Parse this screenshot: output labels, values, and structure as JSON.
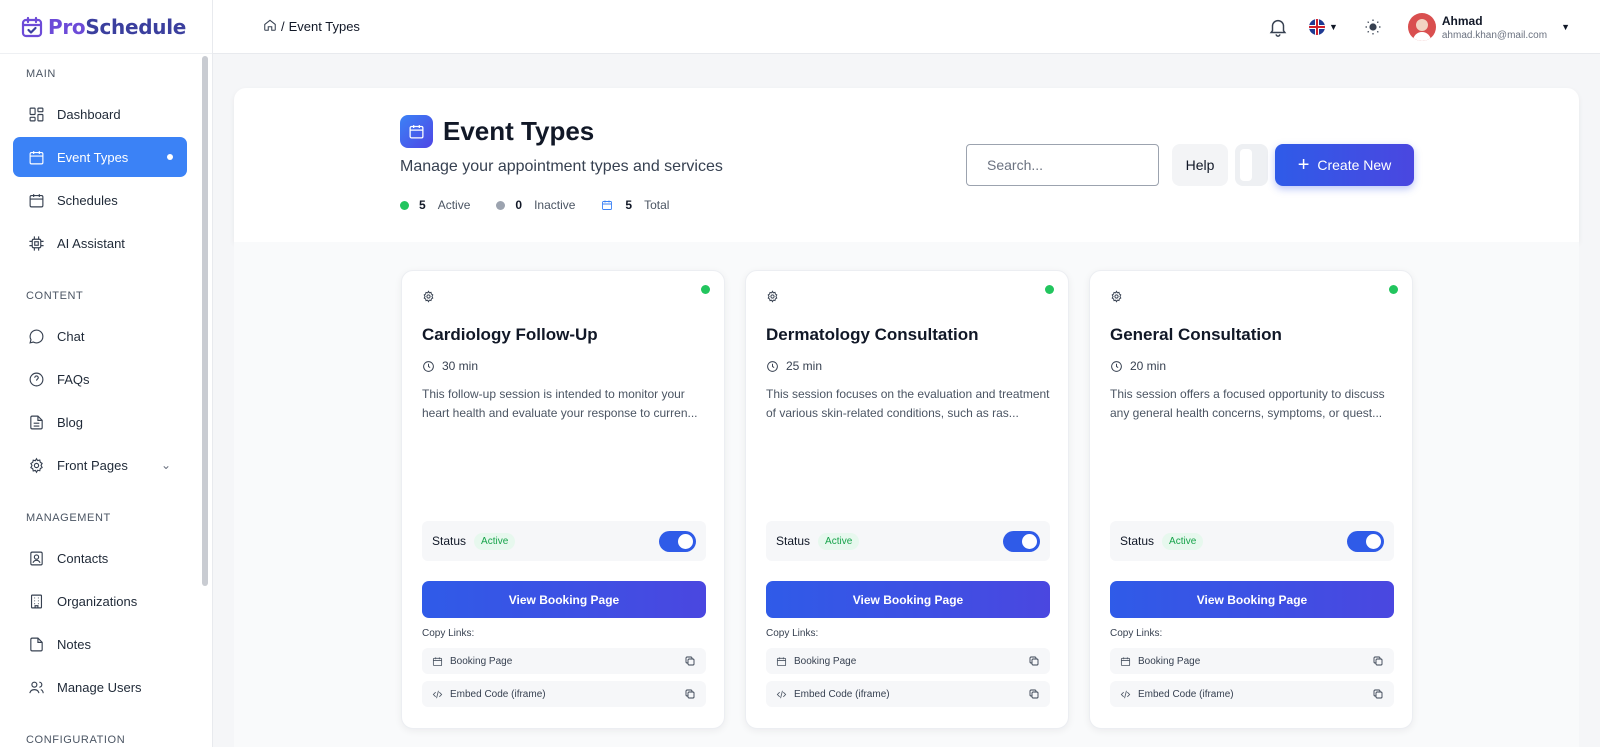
{
  "brand": {
    "name_prefix": "Pro",
    "name_suffix": "Schedule"
  },
  "topbar": {
    "breadcrumb_separator": "/",
    "breadcrumb_current": "Event Types",
    "user_name": "Ahmad",
    "user_email": "ahmad.khan@mail.com"
  },
  "sidebar": {
    "sections": {
      "main": "MAIN",
      "content": "CONTENT",
      "management": "MANAGEMENT",
      "configuration": "CONFIGURATION"
    },
    "items": {
      "dashboard": "Dashboard",
      "event_types": "Event Types",
      "schedules": "Schedules",
      "ai_assistant": "AI Assistant",
      "chat": "Chat",
      "faqs": "FAQs",
      "blog": "Blog",
      "front_pages": "Front Pages",
      "contacts": "Contacts",
      "organizations": "Organizations",
      "notes": "Notes",
      "manage_users": "Manage Users"
    }
  },
  "header": {
    "title": "Event Types",
    "subtitle": "Manage your appointment types and services",
    "stats": {
      "active_count": "5",
      "active_label": "Active",
      "inactive_count": "0",
      "inactive_label": "Inactive",
      "total_count": "5",
      "total_label": "Total"
    },
    "search_placeholder": "Search...",
    "help_label": "Help",
    "create_label": "Create New"
  },
  "cards": [
    {
      "title": "Cardiology Follow-Up",
      "duration": "30 min",
      "description": "This follow-up session is intended to monitor your heart health and evaluate your response to curren...",
      "status_label": "Status",
      "status_badge": "Active",
      "view_button": "View Booking Page",
      "copy_label": "Copy Links:",
      "link_booking": "Booking Page",
      "link_embed": "Embed Code (iframe)"
    },
    {
      "title": "Dermatology Consultation",
      "duration": "25 min",
      "description": "This session focuses on the evaluation and treatment of various skin-related conditions, such as ras...",
      "status_label": "Status",
      "status_badge": "Active",
      "view_button": "View Booking Page",
      "copy_label": "Copy Links:",
      "link_booking": "Booking Page",
      "link_embed": "Embed Code (iframe)"
    },
    {
      "title": "General Consultation",
      "duration": "20 min",
      "description": "This session offers a focused opportunity to discuss any general health concerns, symptoms, or quest...",
      "status_label": "Status",
      "status_badge": "Active",
      "view_button": "View Booking Page",
      "copy_label": "Copy Links:",
      "link_booking": "Booking Page",
      "link_embed": "Embed Code (iframe)"
    }
  ],
  "colors": {
    "primary": "#3b82f6",
    "primary_gradient_start": "#2f5be8",
    "primary_gradient_end": "#4a47e0",
    "active_green": "#22c55e",
    "inactive_gray": "#9ca3af",
    "brand_purple": "#6d4bd8"
  }
}
